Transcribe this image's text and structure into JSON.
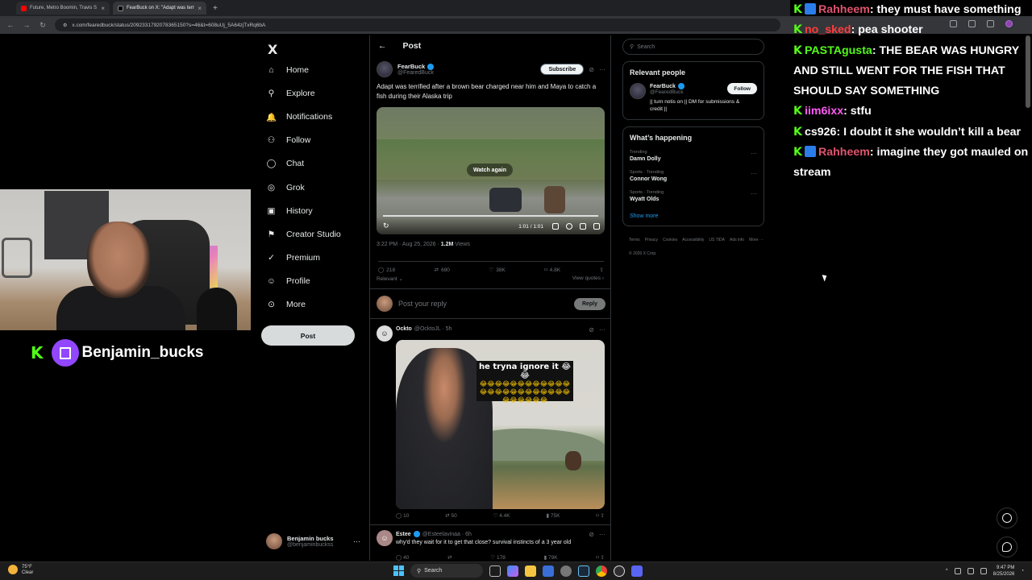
{
  "browser": {
    "tabs": [
      {
        "title": "Future, Metro Boomin, Travis S",
        "favicon_color": "#ff0000"
      },
      {
        "title": "FearBuck on X: \"Adapt was terr",
        "favicon_color": "#000000"
      }
    ],
    "new_tab": "+",
    "url": "x.com/fearedbuck/status/2092331792078365150?s=46&t=608uUj_5A64zjTxRq6bA"
  },
  "nav": {
    "logo": "X",
    "items": [
      {
        "label": "Home",
        "icon": "home-icon",
        "glyph": "⌂"
      },
      {
        "label": "Explore",
        "icon": "search-icon",
        "glyph": "⚲"
      },
      {
        "label": "Notifications",
        "icon": "bell-icon",
        "glyph": "🔔"
      },
      {
        "label": "Follow",
        "icon": "person-add-icon",
        "glyph": "⚇"
      },
      {
        "label": "Chat",
        "icon": "chat-icon",
        "glyph": "◯"
      },
      {
        "label": "Grok",
        "icon": "grok-icon",
        "glyph": "◎"
      },
      {
        "label": "History",
        "icon": "history-icon",
        "glyph": "▣"
      },
      {
        "label": "Creator Studio",
        "icon": "creator-studio-icon",
        "glyph": "⚑"
      },
      {
        "label": "Premium",
        "icon": "premium-icon",
        "glyph": "✓"
      },
      {
        "label": "Profile",
        "icon": "profile-icon",
        "glyph": "☺"
      },
      {
        "label": "More",
        "icon": "more-icon",
        "glyph": "⊙"
      }
    ],
    "post_button": "Post",
    "account": {
      "name": "Benjamin bucks",
      "handle": "@benjaminbuckss",
      "more": "···"
    }
  },
  "post": {
    "header": "Post",
    "back": "←",
    "author": {
      "name": "FearBuck",
      "handle": "@FearedBuck"
    },
    "subscribe": "Subscribe",
    "text": "Adapt was terrified after a brown bear charged near him and Maya to catch a fish during their Alaska trip",
    "video": {
      "overlay": "Watch again",
      "time": "1:01 / 1:01"
    },
    "timestamp": "3:22 PM · Aug 25, 2026 · ",
    "views": "1.2M",
    "views_label": " Views",
    "stats": {
      "replies": "218",
      "reposts": "690",
      "likes": "38K",
      "bookmarks": "4.8K"
    },
    "sort": "Relevant ⌄",
    "view_quotes": "View quotes ›",
    "reply_placeholder": "Post your reply",
    "reply_button": "Reply"
  },
  "replies": [
    {
      "name": "Ockto",
      "handle": "@OcktoJL · 5h",
      "meme_caption": "he tryna ignore it 😂😂",
      "meme_emojis": "😂😂😂😂😂😂😂😂😂😂😂😂😂😂😂😂😂😂😂😂😂😂😂😂😂😂😂😂😂😂",
      "stats": {
        "replies": "10",
        "reposts": "50",
        "likes": "4.4K",
        "views": "75K"
      }
    },
    {
      "name": "Estee",
      "handle": "@Esteelavinaa · 6h",
      "text": "why'd they wait for it to get that close? survival instincts of a 3 year old",
      "stats": {
        "replies": "40",
        "likes": "178",
        "views": "79K"
      }
    }
  ],
  "sidebar": {
    "search_placeholder": "Search",
    "relevant_title": "Relevant people",
    "relevant_person": {
      "name": "FearBuck",
      "handle": "@FearedBuck",
      "bio": "|| turn notis on || DM for submissions & credit ||",
      "follow": "Follow"
    },
    "happening_title": "What’s happening",
    "trends": [
      {
        "category": "Trending",
        "name": "Damn Dolly"
      },
      {
        "category": "Sports · Trending",
        "name": "Connor Wong"
      },
      {
        "category": "Sports · Trending",
        "name": "Wyatt Olds"
      }
    ],
    "show_more": "Show more",
    "footer": [
      "Terms",
      "Privacy",
      "Cookies",
      "Accessibility",
      "US TIDA",
      "Ads info",
      "More ···",
      "© 2026 X Corp."
    ]
  },
  "stream": {
    "streamer_name": "Benjamin_bucks",
    "kick_logo": "K"
  },
  "chat": [
    {
      "user": "Rahheem",
      "color": "#e0546e",
      "badge": true,
      "message": "they must have something"
    },
    {
      "user": "no_sked",
      "color": "#ff3c3c",
      "badge": false,
      "message": "pea shooter"
    },
    {
      "user": "PASTAgusta",
      "color": "#53fc18",
      "badge": false,
      "message": "THE BEAR WAS HUNGRY AND STILL WENT FOR THE FISH THAT SHOULD SAY SOMETHING"
    },
    {
      "user": "iim6ixx",
      "color": "#ff5cf4",
      "badge": false,
      "message": "stfu"
    },
    {
      "user": "cs926",
      "color": "#ffffff",
      "badge": false,
      "message": "I doubt it she wouldn’t kill a bear"
    },
    {
      "user": "Rahheem",
      "color": "#e0546e",
      "badge": true,
      "message": "imagine they got mauled on stream"
    }
  ],
  "taskbar": {
    "weather_temp": "75°F",
    "weather_desc": "Clear",
    "search": "Search",
    "time": "9:47 PM",
    "date": "8/25/2026"
  }
}
